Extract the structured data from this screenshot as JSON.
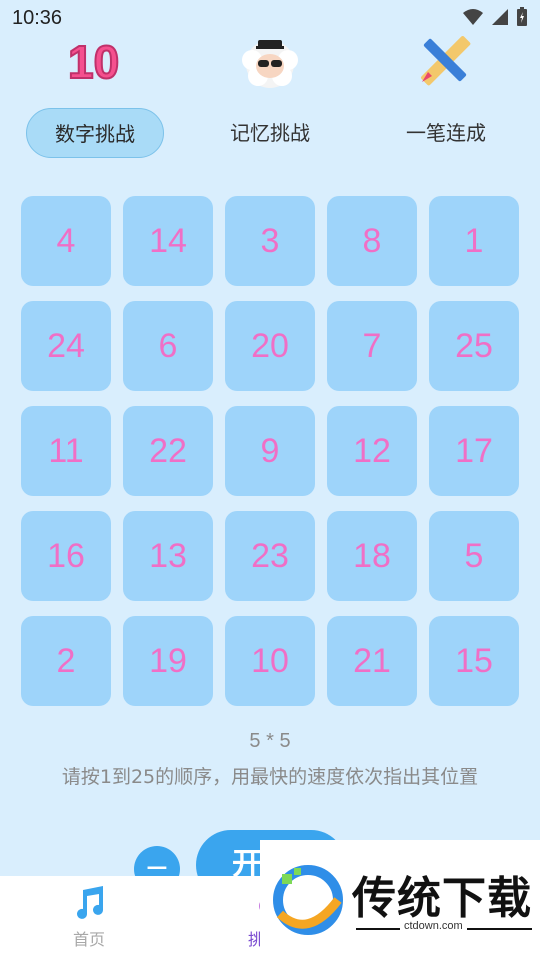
{
  "status_bar": {
    "time": "10:36"
  },
  "top_icons": [
    "number-10-icon",
    "sheep-avatar-icon",
    "pencil-ruler-icon"
  ],
  "tabs": [
    {
      "label": "数字挑战",
      "active": true
    },
    {
      "label": "记忆挑战",
      "active": false
    },
    {
      "label": "一笔连成",
      "active": false
    }
  ],
  "grid": {
    "rows": [
      [
        "4",
        "14",
        "3",
        "8",
        "1"
      ],
      [
        "24",
        "6",
        "20",
        "7",
        "25"
      ],
      [
        "11",
        "22",
        "9",
        "12",
        "17"
      ],
      [
        "16",
        "13",
        "23",
        "18",
        "5"
      ],
      [
        "2",
        "19",
        "10",
        "21",
        "15"
      ]
    ]
  },
  "size_label": "5 * 5",
  "instruction": "请按1到25的顺序，用最快的速度依次指出其位置",
  "controls": {
    "minus_label": "−",
    "start_label": "开"
  },
  "bottom_nav": {
    "items": [
      {
        "label": "首页",
        "icon": "music-note-icon"
      },
      {
        "label": "挑",
        "icon": "challenge-icon"
      }
    ]
  },
  "watermark": {
    "text": "传统下载",
    "url": "ctdown.com"
  },
  "colors": {
    "background": "#d9eefd",
    "cell": "#9ed4fa",
    "cell_text": "#f06fc6",
    "active_tab": "#a9dbf7",
    "button": "#3aa5ee"
  }
}
